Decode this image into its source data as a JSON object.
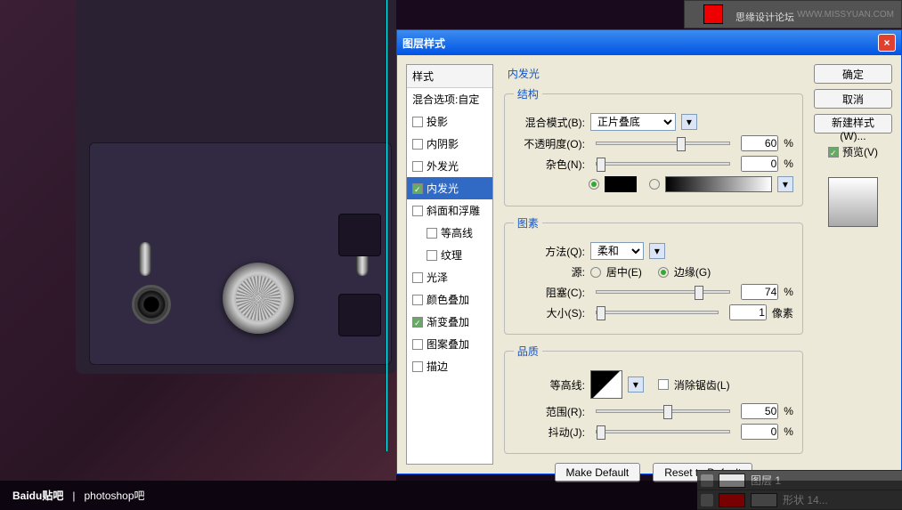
{
  "dialog": {
    "title": "图层样式",
    "styles_header": "样式",
    "blend_options": "混合选项:自定",
    "items": [
      {
        "label": "投影",
        "checked": false
      },
      {
        "label": "内阴影",
        "checked": false
      },
      {
        "label": "外发光",
        "checked": false
      },
      {
        "label": "内发光",
        "checked": true,
        "selected": true
      },
      {
        "label": "斜面和浮雕",
        "checked": false
      },
      {
        "label": "等高线",
        "checked": false,
        "sub": true
      },
      {
        "label": "纹理",
        "checked": false,
        "sub": true
      },
      {
        "label": "光泽",
        "checked": false
      },
      {
        "label": "颜色叠加",
        "checked": false
      },
      {
        "label": "渐变叠加",
        "checked": true
      },
      {
        "label": "图案叠加",
        "checked": false
      },
      {
        "label": "描边",
        "checked": false
      }
    ],
    "section_title": "内发光",
    "structure": {
      "legend": "结构",
      "blend_mode_label": "混合模式(B):",
      "blend_mode_value": "正片叠底",
      "opacity_label": "不透明度(O):",
      "opacity_value": "60",
      "opacity_unit": "%",
      "noise_label": "杂色(N):",
      "noise_value": "0",
      "noise_unit": "%",
      "color_hex": "#000000"
    },
    "elements": {
      "legend": "图素",
      "technique_label": "方法(Q):",
      "technique_value": "柔和",
      "source_label": "源:",
      "source_center": "居中(E)",
      "source_edge": "边缘(G)",
      "source_selected": "edge",
      "choke_label": "阻塞(C):",
      "choke_value": "74",
      "choke_unit": "%",
      "size_label": "大小(S):",
      "size_value": "1",
      "size_unit": "像素"
    },
    "quality": {
      "legend": "品质",
      "contour_label": "等高线:",
      "antialias_label": "消除锯齿(L)",
      "antialias_checked": false,
      "range_label": "范围(R):",
      "range_value": "50",
      "range_unit": "%",
      "jitter_label": "抖动(J):",
      "jitter_value": "0",
      "jitter_unit": "%"
    },
    "make_default": "Make Default",
    "reset_default": "Reset to Default",
    "ok": "确定",
    "cancel": "取消",
    "new_style": "新建样式(W)...",
    "preview": "预览(V)"
  },
  "top": {
    "brand": "思缘设计论坛",
    "watermark": "WWW.MISSYUAN.COM"
  },
  "layers": {
    "rows": [
      {
        "name": "图层 1"
      },
      {
        "name": "形状 14..."
      }
    ]
  },
  "footer": {
    "logo": "Baidu贴吧",
    "sep": "|",
    "name": "photoshop吧"
  },
  "chart_data": null
}
